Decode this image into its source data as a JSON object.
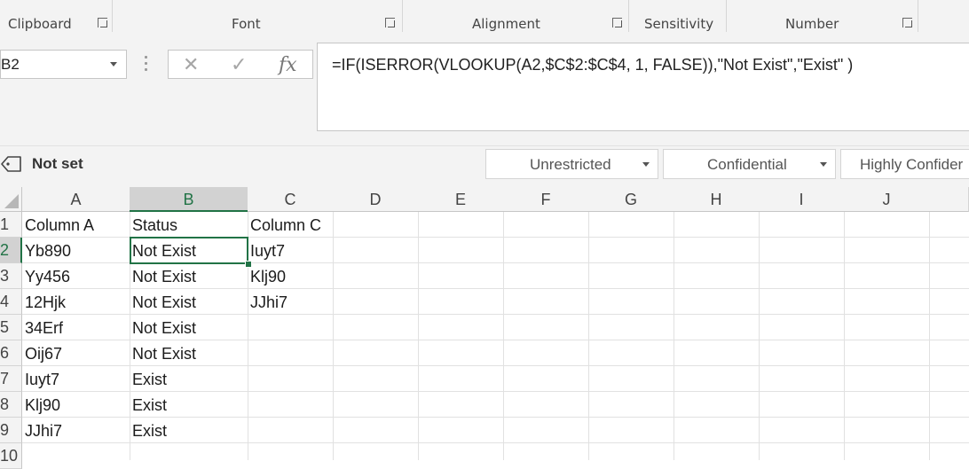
{
  "ribbon": {
    "groups": [
      {
        "label": "Clipboard"
      },
      {
        "label": "Font"
      },
      {
        "label": "Alignment"
      },
      {
        "label": "Sensitivity"
      },
      {
        "label": "Number"
      }
    ]
  },
  "formula_bar": {
    "name_box": "B2",
    "cancel_icon": "✕",
    "enter_icon": "✓",
    "fx_label": "fx",
    "formula": "=IF(ISERROR(VLOOKUP(A2,$C$2:$C$4, 1, FALSE)),\"Not Exist\",\"Exist\" )"
  },
  "sensitivity": {
    "current": "Not set",
    "options": [
      "Unrestricted",
      "Confidential",
      "Highly Confider"
    ]
  },
  "sheet": {
    "columns": [
      "A",
      "B",
      "C",
      "D",
      "E",
      "F",
      "G",
      "H",
      "I",
      "J"
    ],
    "selected_column": "B",
    "selected_row": "2",
    "rows": [
      {
        "num": "1",
        "cells": [
          "Column A",
          "Status",
          "Column C"
        ]
      },
      {
        "num": "2",
        "cells": [
          "Yb890",
          "Not Exist",
          "Iuyt7"
        ]
      },
      {
        "num": "3",
        "cells": [
          "Yy456",
          "Not Exist",
          "Klj90"
        ]
      },
      {
        "num": "4",
        "cells": [
          "12Hjk",
          "Not Exist",
          "JJhi7"
        ]
      },
      {
        "num": "5",
        "cells": [
          "34Erf",
          "Not Exist",
          ""
        ]
      },
      {
        "num": "6",
        "cells": [
          "Oij67",
          "Not Exist",
          ""
        ]
      },
      {
        "num": "7",
        "cells": [
          "Iuyt7",
          "Exist",
          ""
        ]
      },
      {
        "num": "8",
        "cells": [
          "Klj90",
          "Exist",
          ""
        ]
      },
      {
        "num": "9",
        "cells": [
          "JJhi7",
          "Exist",
          ""
        ]
      },
      {
        "num": "10",
        "cells": [
          "",
          "",
          ""
        ]
      }
    ]
  },
  "colors": {
    "accent_green": "#217346",
    "header_bg": "#f3f3f3",
    "selected_header_bg": "#d2d2d2"
  }
}
